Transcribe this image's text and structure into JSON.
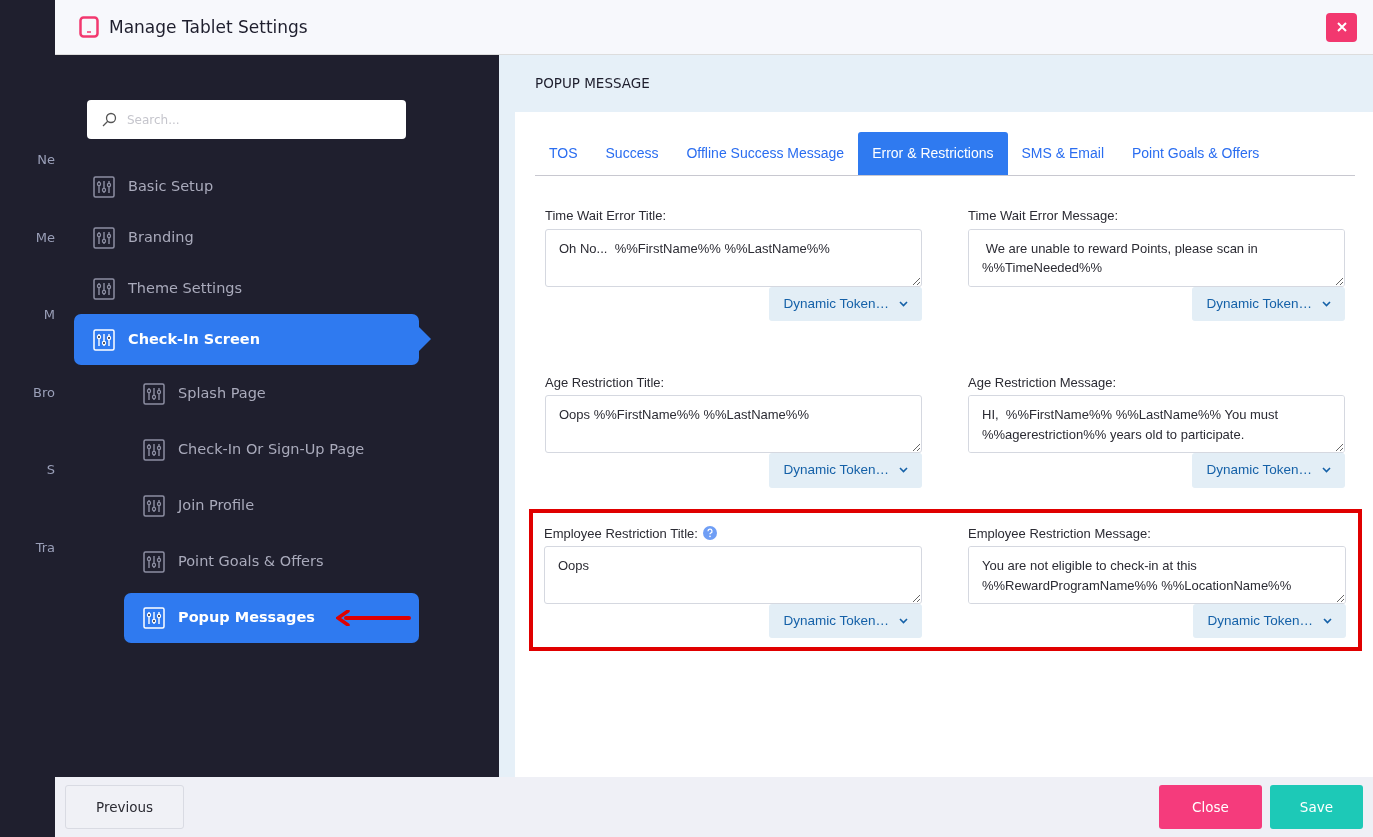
{
  "background_menu": [
    "Ne",
    "Me",
    "M",
    "Bro",
    "S",
    "Tra"
  ],
  "window": {
    "title": "Manage Tablet Settings"
  },
  "search": {
    "placeholder": "Search..."
  },
  "sidebar": {
    "items": [
      {
        "label": "Basic Setup",
        "selected": false
      },
      {
        "label": "Branding",
        "selected": false
      },
      {
        "label": "Theme Settings",
        "selected": false
      },
      {
        "label": "Check-In Screen",
        "selected": true,
        "children": [
          {
            "label": "Splash Page",
            "selected": false,
            "pointed": false
          },
          {
            "label": "Check-In Or Sign-Up Page",
            "selected": false,
            "pointed": false
          },
          {
            "label": "Join Profile",
            "selected": false,
            "pointed": false
          },
          {
            "label": "Point Goals & Offers",
            "selected": false,
            "pointed": false
          },
          {
            "label": "Popup Messages",
            "selected": true,
            "pointed": true
          }
        ]
      }
    ]
  },
  "section": {
    "title": "POPUP MESSAGE"
  },
  "tabs": [
    {
      "label": "TOS",
      "selected": false
    },
    {
      "label": "Success",
      "selected": false
    },
    {
      "label": "Offline Success Message",
      "selected": false
    },
    {
      "label": "Error & Restrictions",
      "selected": true
    },
    {
      "label": "SMS & Email",
      "selected": false
    },
    {
      "label": "Point Goals & Offers",
      "selected": false
    }
  ],
  "rows": [
    {
      "highlighted": false,
      "fields": [
        {
          "label": "Time Wait Error Title:",
          "value": "Oh No...  %%FirstName%% %%LastName%%",
          "help": false,
          "button": "Dynamic Token…"
        },
        {
          "label": "Time Wait Error Message:",
          "value": " We are unable to reward Points, please scan in %%TimeNeeded%%",
          "help": false,
          "button": "Dynamic Token…"
        }
      ]
    },
    {
      "highlighted": false,
      "fields": [
        {
          "label": "Age Restriction Title:",
          "value": "Oops %%FirstName%% %%LastName%%",
          "help": false,
          "button": "Dynamic Token…"
        },
        {
          "label": "Age Restriction Message:",
          "value": "HI,  %%FirstName%% %%LastName%% You must %%agerestriction%% years old to participate.",
          "help": false,
          "button": "Dynamic Token…"
        }
      ]
    },
    {
      "highlighted": true,
      "fields": [
        {
          "label": "Employee Restriction Title:",
          "value": "Oops",
          "help": true,
          "button": "Dynamic Token…"
        },
        {
          "label": "Employee Restriction Message:",
          "value": "You are not eligible to check-in at this %%RewardProgramName%% %%LocationName%%",
          "help": false,
          "button": "Dynamic Token…"
        }
      ]
    }
  ],
  "footer": {
    "buttons": [
      {
        "label": "Previous",
        "kind": "secondary"
      },
      {
        "label": "Close",
        "kind": "danger"
      },
      {
        "label": "Save",
        "kind": "success"
      }
    ]
  }
}
